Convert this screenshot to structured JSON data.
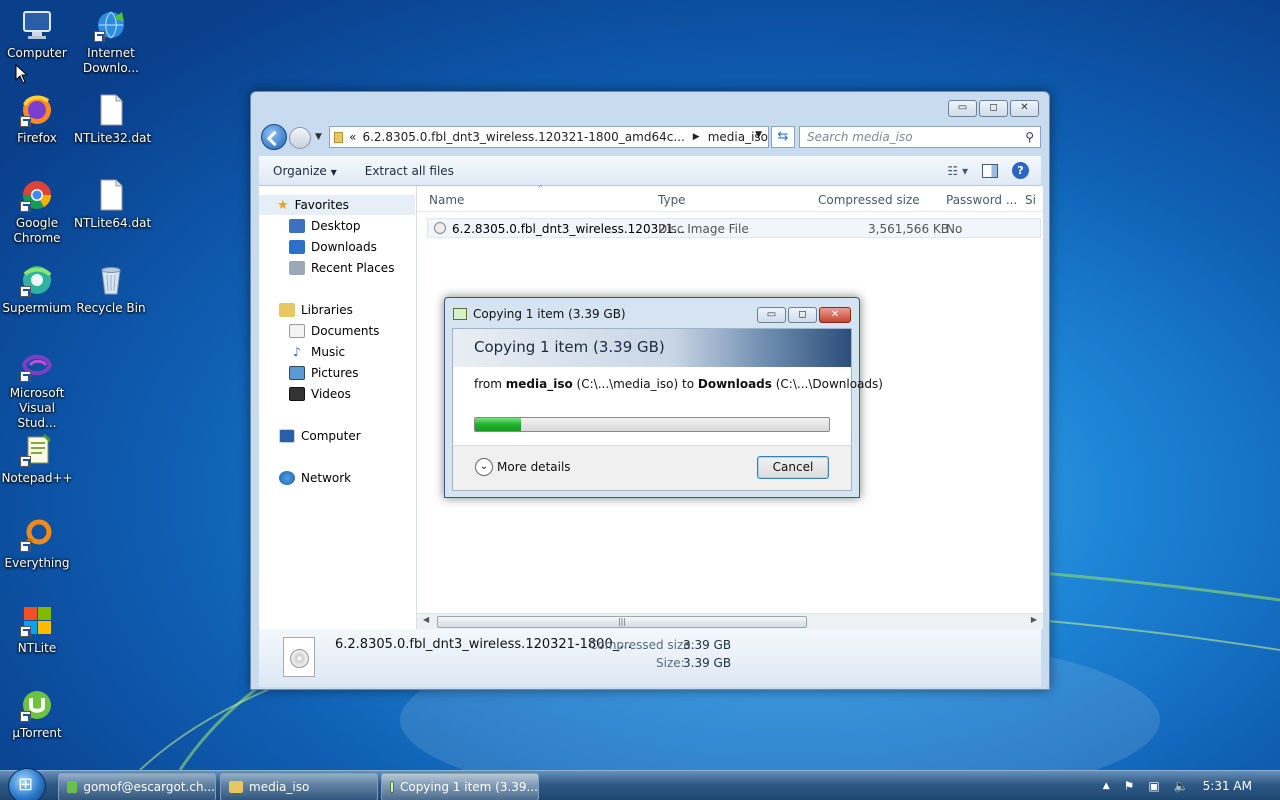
{
  "desktop": {
    "icons": [
      {
        "label": "Computer"
      },
      {
        "label": "Internet Downlo..."
      },
      {
        "label": "Firefox"
      },
      {
        "label": "NTLite32.dat"
      },
      {
        "label": "Google Chrome"
      },
      {
        "label": "NTLite64.dat"
      },
      {
        "label": "Supermium"
      },
      {
        "label": "Recycle Bin"
      },
      {
        "label": "Microsoft Visual Stud..."
      },
      {
        "label": "Notepad++"
      },
      {
        "label": "Everything"
      },
      {
        "label": "NTLite"
      },
      {
        "label": "µTorrent"
      }
    ]
  },
  "explorer": {
    "path_prefix": "«",
    "path_segment_1": "6.2.8305.0.fbl_dnt3_wireless.120321-1800_amd64c...",
    "path_segment_2": "media_iso",
    "search_placeholder": "Search media_iso",
    "toolbar": {
      "organize": "Organize",
      "extract": "Extract all files"
    },
    "nav": {
      "favorites": "Favorites",
      "desktop": "Desktop",
      "downloads": "Downloads",
      "recent": "Recent Places",
      "libraries": "Libraries",
      "documents": "Documents",
      "music": "Music",
      "pictures": "Pictures",
      "videos": "Videos",
      "computer": "Computer",
      "network": "Network"
    },
    "columns": {
      "name": "Name",
      "type": "Type",
      "compressed": "Compressed size",
      "password": "Password ...",
      "size": "Si"
    },
    "files": [
      {
        "name": "6.2.8305.0.fbl_dnt3_wireless.120321...",
        "type": "Disc Image File",
        "compressed": "3,561,566 KB",
        "password": "No"
      }
    ],
    "details": {
      "filename": "6.2.8305.0.fbl_dnt3_wireless.120321-1800_...",
      "compressed_label": "Compressed size:",
      "compressed_value": "3.39 GB",
      "size_label": "Size:",
      "size_value": "3.39 GB"
    }
  },
  "copy_dialog": {
    "title": "Copying 1 item (3.39 GB)",
    "heading": "Copying 1 item (3.39 GB)",
    "from_word": "from",
    "source_name": "media_iso",
    "source_path": "(C:\\...\\media_iso)",
    "to_word": "to",
    "dest_name": "Downloads",
    "dest_path": "(C:\\...\\Downloads)",
    "progress_fraction": 0.13,
    "more_details": "More details",
    "cancel": "Cancel"
  },
  "taskbar": {
    "items": [
      {
        "label": "gomof@escargot.ch..."
      },
      {
        "label": "media_iso"
      },
      {
        "label": "Copying 1 item (3.39..."
      }
    ],
    "clock": "5:31 AM"
  },
  "colors": {
    "progress_green": "#1fb32a",
    "taskbar": "#2f5a86",
    "window_frame": "#c9dcef"
  }
}
